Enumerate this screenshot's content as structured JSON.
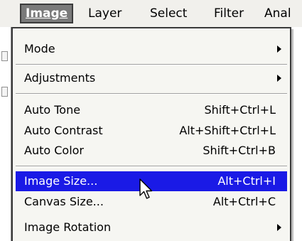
{
  "menubar": {
    "items": [
      {
        "label": "Image"
      },
      {
        "label": "Layer"
      },
      {
        "label": "Select"
      },
      {
        "label": "Filter"
      },
      {
        "label": "Anal"
      }
    ]
  },
  "menu": {
    "items": [
      {
        "label": "Mode",
        "shortcut": ""
      },
      {
        "label": "Adjustments",
        "shortcut": ""
      },
      {
        "label": "Auto Tone",
        "shortcut": "Shift+Ctrl+L"
      },
      {
        "label": "Auto Contrast",
        "shortcut": "Alt+Shift+Ctrl+L"
      },
      {
        "label": "Auto Color",
        "shortcut": "Shift+Ctrl+B"
      },
      {
        "label": "Image Size...",
        "shortcut": "Alt+Ctrl+I"
      },
      {
        "label": "Canvas Size...",
        "shortcut": "Alt+Ctrl+C"
      },
      {
        "label": "Image Rotation",
        "shortcut": ""
      }
    ]
  },
  "colors": {
    "highlight": "#1a1ae6",
    "menu_background": "#f6f6f2",
    "active_menubar_item": "#7a7a7a"
  },
  "icons": {
    "submenu_arrow": "triangle-right-icon",
    "cursor": "arrow-cursor-icon"
  }
}
